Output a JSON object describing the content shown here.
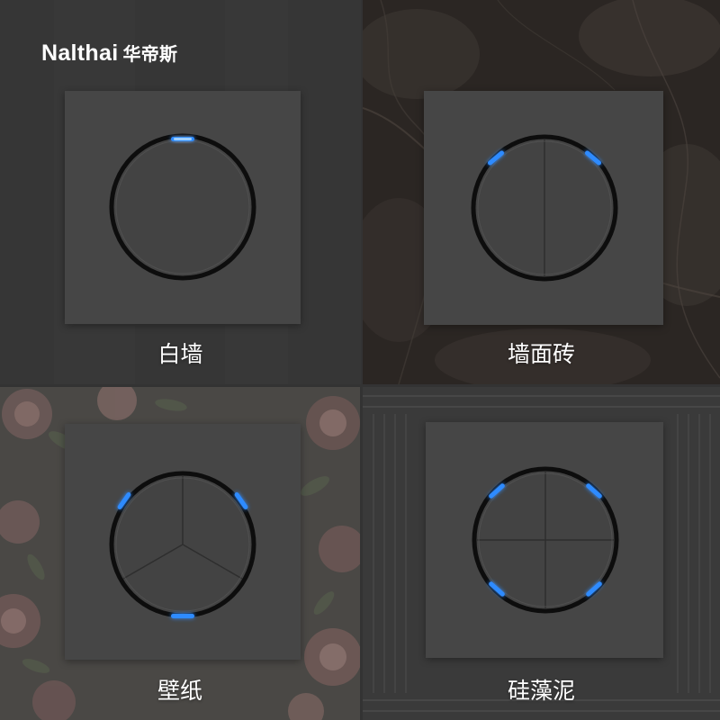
{
  "brand": {
    "name_latin": "Nalthai",
    "name_cn": "华帝斯"
  },
  "tiles": [
    {
      "label": "白墙",
      "background": "white-wall",
      "gang_count": 1,
      "indicator_color": "#2f8bff"
    },
    {
      "label": "墙面砖",
      "background": "marble-tile",
      "gang_count": 2,
      "indicator_color": "#2f8bff"
    },
    {
      "label": "壁纸",
      "background": "floral-wallpaper",
      "gang_count": 3,
      "indicator_color": "#2f8bff"
    },
    {
      "label": "硅藻泥",
      "background": "diatom-mud-relief",
      "gang_count": 4,
      "indicator_color": "#2f8bff"
    }
  ],
  "colors": {
    "panel": "#464646",
    "ring": "#0d0d0d",
    "glow": "#2f8bff",
    "text": "#ffffff"
  }
}
